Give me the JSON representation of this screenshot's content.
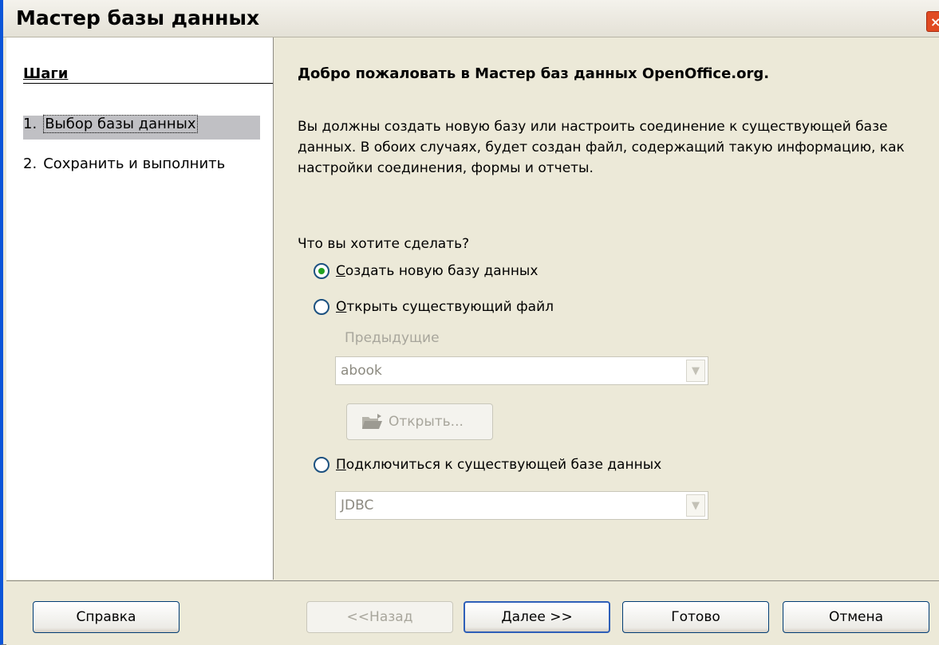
{
  "window": {
    "title": "Мастер базы данных",
    "close_glyph": "×"
  },
  "steps": {
    "title": "Шаги",
    "items": [
      {
        "num": "1.",
        "label": "Выбор базы данных"
      },
      {
        "num": "2.",
        "label": "Сохранить и выполнить"
      }
    ]
  },
  "content": {
    "welcome": "Добро пожаловать в Мастер баз данных OpenOffice.org.",
    "intro": "Вы должны создать новую базу или настроить соединение к существующей базе данных. В обоих случаях, будет создан файл, содержащий такую информацию, как настройки соединения, формы и отчеты.",
    "question": "Что вы хотите сделать?",
    "options": [
      {
        "first": "С",
        "rest": "оздать новую базу данных",
        "checked": true
      },
      {
        "first": "О",
        "rest": "ткрыть существующий файл",
        "checked": false
      },
      {
        "first": "П",
        "rest": "одключиться к существующей базе данных",
        "checked": false
      }
    ],
    "recent_label": "Предыдущие",
    "recent_value": "abook",
    "open_button": "Открыть...",
    "connection_value": "JDBC"
  },
  "buttons": {
    "help": "Справка",
    "back": "<<Назад",
    "next": "Далее >>",
    "finish": "Готово",
    "cancel": "Отмена"
  },
  "colors": {
    "window_border": "#0b55d8",
    "dialog_bg": "#ece9d8",
    "selection": "#c0c0c4",
    "radio_dot": "#21a121"
  }
}
